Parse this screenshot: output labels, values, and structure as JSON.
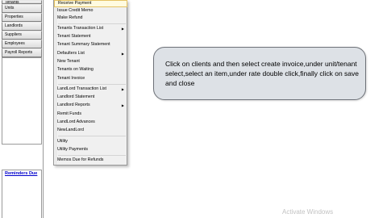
{
  "sidebar": {
    "items": [
      {
        "label": "Tenants"
      },
      {
        "label": "Units"
      },
      {
        "label": "Properties"
      },
      {
        "label": "Landlords"
      },
      {
        "label": "Suppliers"
      },
      {
        "label": "Employees"
      },
      {
        "label": "Payroll Reports"
      }
    ],
    "reminders_label": "Reminders Due"
  },
  "menu": {
    "items": [
      {
        "label": "Receive Payment",
        "submenu": false
      },
      {
        "label": "Issue Credit Memo",
        "submenu": false
      },
      {
        "label": "Make Refund",
        "submenu": false
      },
      {
        "label": "Tenants Transaction List",
        "submenu": true
      },
      {
        "label": "Tenant Statement",
        "submenu": false
      },
      {
        "label": "Tenant Summary Statement",
        "submenu": false
      },
      {
        "label": "Defaulters List",
        "submenu": true
      },
      {
        "label": "New Tenant",
        "submenu": false
      },
      {
        "label": "Tenants on Waiting",
        "submenu": false
      },
      {
        "label": "Tenant Invoice",
        "submenu": false
      },
      {
        "label": "LandLord Transaction List",
        "submenu": true
      },
      {
        "label": "Landlord Statement",
        "submenu": false
      },
      {
        "label": "Landlord Reports",
        "submenu": true
      },
      {
        "label": "Remit Funds",
        "submenu": false
      },
      {
        "label": "LandLord Advances",
        "submenu": false
      },
      {
        "label": "NewLandLord",
        "submenu": false
      },
      {
        "label": "Utility",
        "submenu": false
      },
      {
        "label": "Utility Payments",
        "submenu": false
      },
      {
        "label": "Memos Due for Refunds",
        "submenu": false
      }
    ],
    "arrow_glyph": "▶"
  },
  "callout": {
    "text": "Click on clients  and then select create invoice,under unit/tenant select,select an item,under rate double click,finally click on save and close"
  },
  "watermark": "Activate Windows",
  "colors": {
    "callout_fill": "#dde1e6",
    "callout_border": "#6d7178",
    "menu_bg": "#f0f0f0",
    "highlight_fill": "#fffbe0",
    "highlight_border": "#e5c365",
    "link": "#0000cc"
  }
}
